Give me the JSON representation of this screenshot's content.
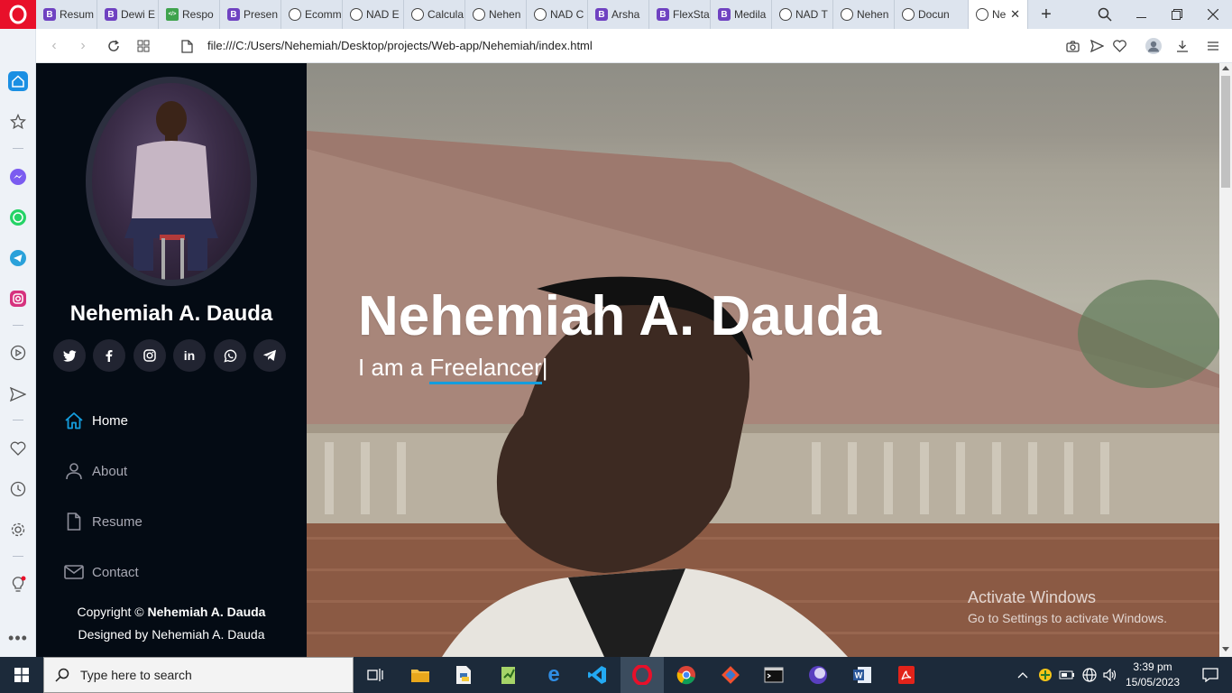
{
  "browser": {
    "tabs": [
      {
        "label": "Resum",
        "icon": "bootstrap-icon"
      },
      {
        "label": "Dewi E",
        "icon": "bootstrap-icon"
      },
      {
        "label": "Respo",
        "icon": "code-icon"
      },
      {
        "label": "Presen",
        "icon": "bootstrap-icon"
      },
      {
        "label": "Ecomm",
        "icon": "globe-icon"
      },
      {
        "label": "NAD E",
        "icon": "globe-icon"
      },
      {
        "label": "Calcula",
        "icon": "globe-icon"
      },
      {
        "label": "Nehen",
        "icon": "globe-icon"
      },
      {
        "label": "NAD C",
        "icon": "globe-icon"
      },
      {
        "label": "Arsha",
        "icon": "bootstrap-icon"
      },
      {
        "label": "FlexSta",
        "icon": "bootstrap-icon"
      },
      {
        "label": "Medila",
        "icon": "bootstrap-icon"
      },
      {
        "label": "NAD T",
        "icon": "globe-icon"
      },
      {
        "label": "Nehen",
        "icon": "globe-icon"
      },
      {
        "label": "Docun",
        "icon": "globe-icon"
      },
      {
        "label": "Ne",
        "icon": "globe-icon",
        "active": true
      }
    ],
    "url": "file:///C:/Users/Nehemiah/Desktop/projects/Web-app/Nehemiah/index.html"
  },
  "sidebar": {
    "name": "Nehemiah A. Dauda",
    "social": [
      "twitter-icon",
      "facebook-icon",
      "instagram-icon",
      "linkedin-icon",
      "whatsapp-icon",
      "telegram-icon"
    ],
    "nav": [
      {
        "label": "Home",
        "icon": "home-icon",
        "active": true
      },
      {
        "label": "About",
        "icon": "person-icon"
      },
      {
        "label": "Resume",
        "icon": "file-icon"
      },
      {
        "label": "Contact",
        "icon": "envelope-icon"
      }
    ],
    "copyright_prefix": "Copyright ©",
    "copyright_name": "Nehemiah A. Dauda",
    "designed_by": "Designed by Nehemiah A. Dauda"
  },
  "hero": {
    "title": "Nehemiah A. Dauda",
    "subtitle_prefix": "I am a",
    "typed_word": "Freelancer",
    "cursor": "|"
  },
  "watermark": {
    "line1": "Activate Windows",
    "line2": "Go to Settings to activate Windows."
  },
  "taskbar": {
    "search_placeholder": "Type here to search",
    "time": "3:39 pm",
    "date": "15/05/2023"
  },
  "colors": {
    "accent": "#149ddd",
    "nav_bg": "#040b14",
    "opera_red": "#e8102a"
  }
}
